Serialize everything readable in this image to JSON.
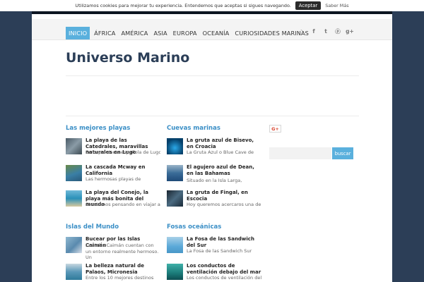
{
  "cookie": {
    "text": "Utilizamos cookies para mejorar tu experiencia. Entendemos que aceptas si sigues navegando.",
    "accept_label": "Aceptar",
    "more_label": "Saber Más"
  },
  "nav": {
    "items": [
      "INICIO",
      "ÁFRICA",
      "AMÉRICA",
      "ASIA",
      "EUROPA",
      "OCEANÍA",
      "CURIOSIDADES MARINAS"
    ],
    "social_icons": [
      "rss-icon",
      "facebook-icon",
      "twitter-icon",
      "pinterest-icon",
      "google-plus-icon"
    ],
    "social_glyphs": [
      "◝",
      "f",
      "t",
      "ⓟ",
      "g+"
    ]
  },
  "site": {
    "title": "Universo Marino"
  },
  "sections": [
    {
      "title": "Las mejores playas",
      "posts": [
        {
          "title": "La playa de las Catedrales, maravillas naturales en Lugo",
          "excerpt": "En la provincia española de Lugo"
        },
        {
          "title": "La cascada Mcway en California",
          "excerpt": "Las hermosas playas de"
        },
        {
          "title": "La playa del Conejo, la playa más bonita del mundo",
          "excerpt": "Si estamos pensando en viajar a"
        }
      ]
    },
    {
      "title": "Cuevas marinas",
      "posts": [
        {
          "title": "La gruta azul de Bisevo, en Croacia",
          "excerpt": "La Gruta Azul o Blue Cave de"
        },
        {
          "title": "El agujero azul de Dean, en las Bahamas",
          "excerpt": "Situado en la Isla Larga,"
        },
        {
          "title": "La gruta de Fingal, en Escocia",
          "excerpt": "Hoy queremos acercaros una de"
        }
      ]
    },
    {
      "title": "Islas del Mundo",
      "posts": [
        {
          "title": "Bucear por las Islas Caimán",
          "excerpt": "Las Islas Caimán cuentan con un entorno realmente hermoso. Un"
        },
        {
          "title": "La belleza natural de Palaos, Micronesia",
          "excerpt": "Entre los 10 mejores destinos"
        }
      ]
    },
    {
      "title": "Fosas oceánicas",
      "posts": [
        {
          "title": "La Fosa de las Sandwich del Sur",
          "excerpt": "La Fosa de las Sandwich Sur"
        },
        {
          "title": "Los conductos de ventilación debajo del mar",
          "excerpt": "Los conductos de ventilación del"
        }
      ]
    }
  ],
  "sidebar": {
    "gplus_label": "G+",
    "search_button": "buscar"
  },
  "colors": {
    "accent": "#5ab0dd",
    "title": "#2b3e57",
    "section": "#3b8fc6",
    "background": "#2c3e57"
  }
}
